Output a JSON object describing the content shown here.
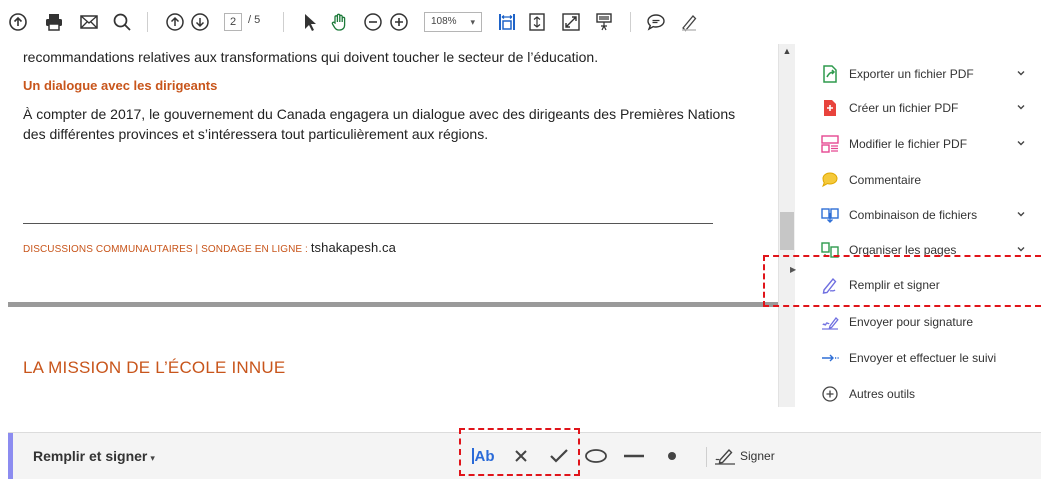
{
  "toolbar": {
    "page_current": "2",
    "page_total": "/ 5",
    "zoom_value": "108%",
    "icons": [
      "upload-icon",
      "print-icon",
      "email-icon",
      "search-icon",
      "page-up-icon",
      "page-down-icon",
      "select-cursor-icon",
      "hand-tool-icon",
      "zoom-out-icon",
      "zoom-in-icon",
      "fit-width-icon",
      "fit-page-icon",
      "full-screen-icon",
      "read-mode-icon",
      "comment-icon",
      "highlight-pen-icon"
    ]
  },
  "document": {
    "line1": "recommandations relatives aux transformations qui doivent toucher le secteur de l’éducation.",
    "heading": "Un dialogue avec les dirigeants",
    "paragraph": "À compter de 2017, le gouvernement du Canada engagera un dialogue avec des dirigeants des Premières Nations des différentes provinces et s’intéressera tout particulièrement aux régions.",
    "footer_label": "DISCUSSIONS COMMUNAUTAIRES | SONDAGE EN LIGNE : ",
    "footer_url": "tshakapesh.ca",
    "mission_title": "LA MISSION DE L’ÉCOLE INNUE"
  },
  "tools_pane": {
    "items": [
      {
        "label": "Exporter un fichier PDF",
        "has_chevron": true,
        "icon": "export-pdf-icon"
      },
      {
        "label": "Créer un fichier PDF",
        "has_chevron": true,
        "icon": "create-pdf-icon"
      },
      {
        "label": "Modifier le fichier PDF",
        "has_chevron": true,
        "icon": "edit-pdf-icon"
      },
      {
        "label": "Commentaire",
        "has_chevron": false,
        "icon": "comment-icon"
      },
      {
        "label": "Combinaison de fichiers",
        "has_chevron": true,
        "icon": "combine-files-icon"
      },
      {
        "label": "Organiser les pages",
        "has_chevron": true,
        "icon": "organize-pages-icon"
      },
      {
        "label": "Remplir et signer",
        "has_chevron": false,
        "icon": "fill-sign-icon"
      },
      {
        "label": "Envoyer pour signature",
        "has_chevron": false,
        "icon": "send-signature-icon"
      },
      {
        "label": "Envoyer et effectuer le suivi",
        "has_chevron": false,
        "icon": "send-track-icon"
      },
      {
        "label": "Autres outils",
        "has_chevron": false,
        "icon": "more-tools-icon"
      }
    ]
  },
  "fill_sign_bar": {
    "title": "Remplir et signer",
    "text_tool_label": "Ab",
    "sign_label": "Signer",
    "tools": [
      "add-text-icon",
      "cross-mark-icon",
      "check-mark-icon",
      "ellipse-icon",
      "line-icon",
      "dot-icon"
    ]
  },
  "colors": {
    "accent_orange": "#c8551b",
    "highlight_red": "#e0141a",
    "fill_bar_accent": "#8c8cf0",
    "link_blue": "#2a6ad8"
  }
}
